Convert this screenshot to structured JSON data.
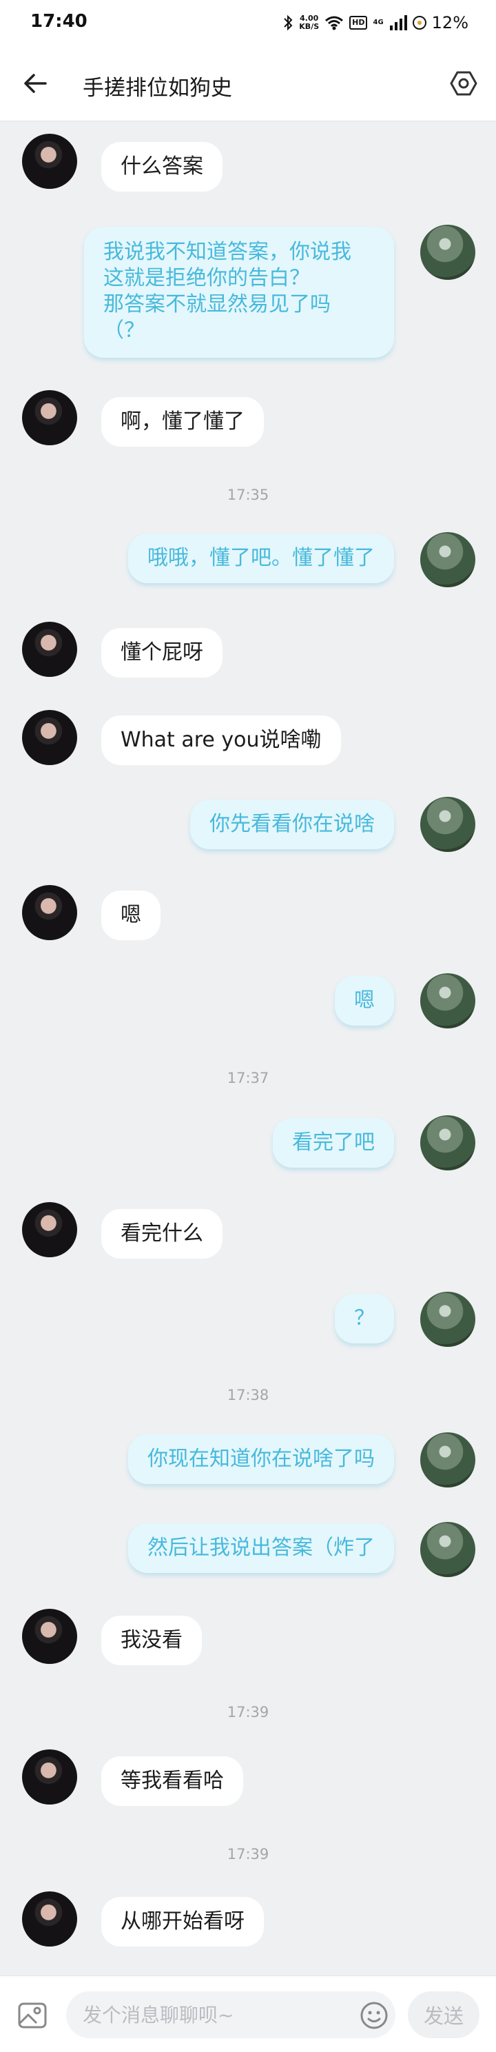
{
  "status_bar": {
    "time": "17:40",
    "net_speed_value": "4.00",
    "net_speed_unit": "KB/S",
    "hd_badge": "HD",
    "signal_label": "4G",
    "battery": "12%"
  },
  "header": {
    "title": "手搓排位如狗史"
  },
  "messages": [
    {
      "text": "什么答案"
    },
    {
      "text": "我说我不知道答案，你说我\n这就是拒绝你的告白？\n那答案不就显然易见了吗\n（？"
    },
    {
      "text": "啊，懂了懂了"
    },
    {
      "text": "哦哦，懂了吧。懂了懂了"
    },
    {
      "text": "懂个屁呀"
    },
    {
      "text": "What are you说啥嘞"
    },
    {
      "text": "你先看看你在说啥"
    },
    {
      "text": "嗯"
    },
    {
      "text": "嗯"
    },
    {
      "text": "看完了吧"
    },
    {
      "text": "看完什么"
    },
    {
      "text": "？"
    },
    {
      "text": "你现在知道你在说啥了吗"
    },
    {
      "text": "然后让我说出答案（炸了"
    },
    {
      "text": "我没看"
    },
    {
      "text": "等我看看哈"
    },
    {
      "text": "从哪开始看呀"
    }
  ],
  "timestamps": [
    "17:35",
    "17:37",
    "17:38",
    "17:39",
    "17:39"
  ],
  "input": {
    "placeholder": "发个消息聊聊呗~",
    "send_label": "发送"
  },
  "colors": {
    "page_background": "#eef0f2",
    "incoming_bubble": "#ffffff",
    "outgoing_bubble": "#e4f7fc",
    "outgoing_text": "#47b9dc"
  },
  "icons": {
    "back": "arrow-left-icon",
    "settings": "hexagon-gear-icon",
    "bluetooth": "bluetooth-icon",
    "wifi": "wifi-icon",
    "signal": "signal-bars-icon",
    "battery": "battery-icon",
    "image": "image-icon",
    "emoji": "emoji-icon"
  }
}
